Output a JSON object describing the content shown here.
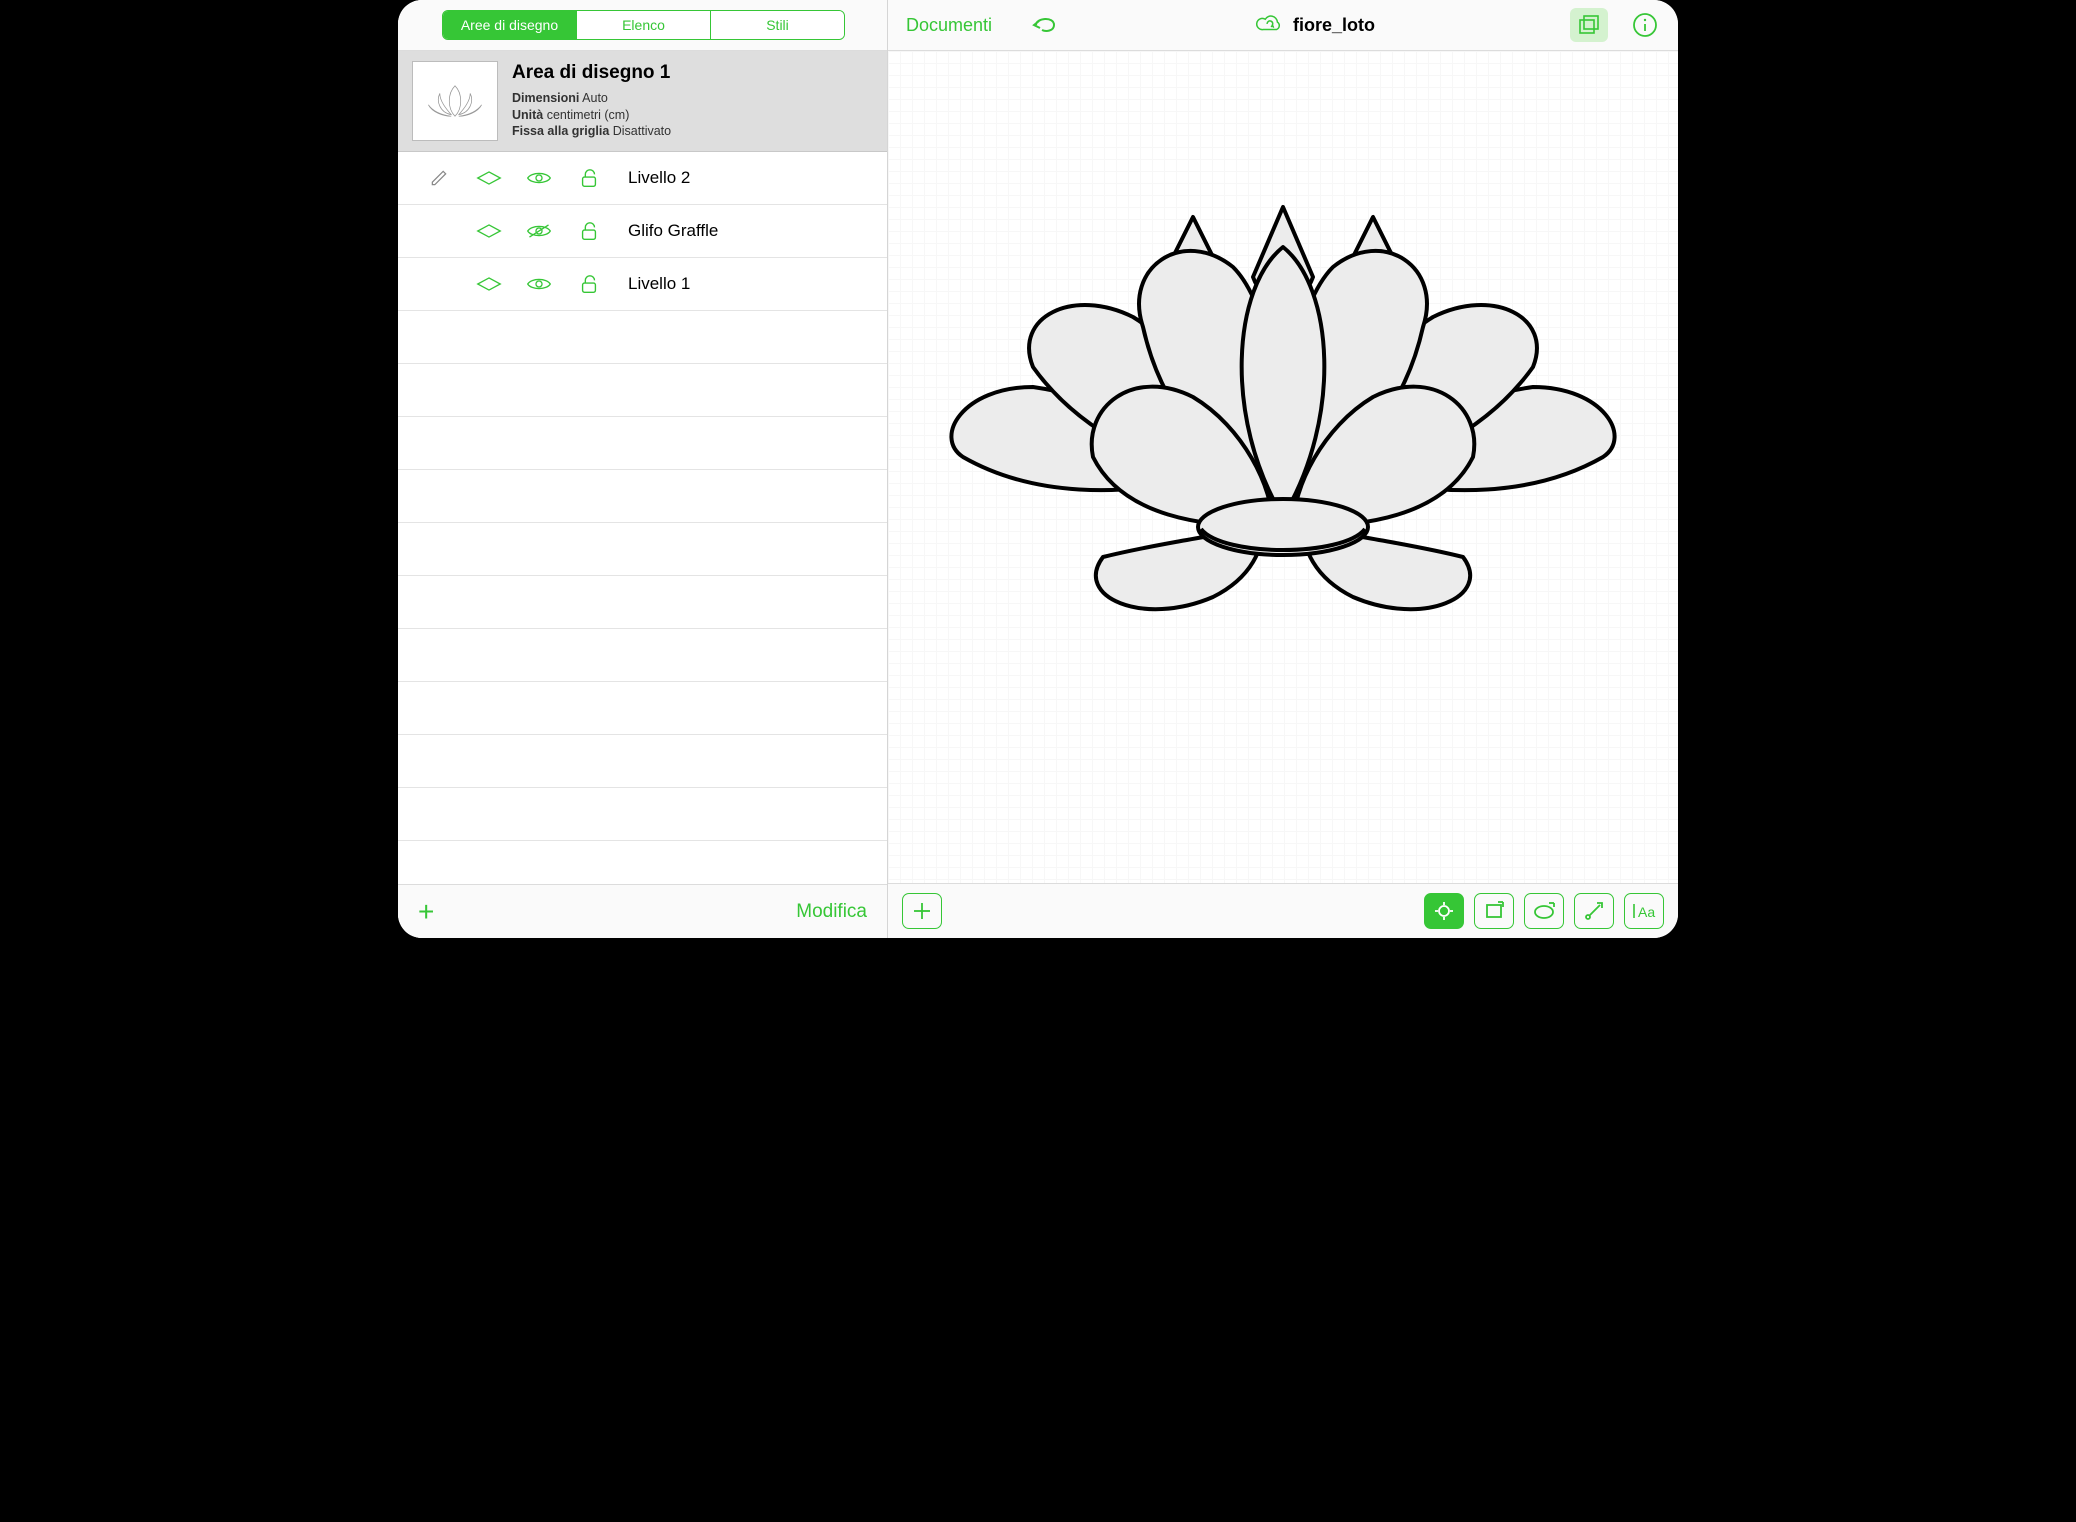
{
  "sidebar": {
    "tabs": {
      "artboards": "Aree di disegno",
      "list": "Elenco",
      "styles": "Stili",
      "active": 0
    },
    "artboard": {
      "title": "Area di disegno 1",
      "dimensions_label": "Dimensioni",
      "dimensions_value": "Auto",
      "units_label": "Unità",
      "units_value": "centimetri (cm)",
      "snap_label": "Fissa alla griglia",
      "snap_value": "Disattivato"
    },
    "layers": [
      {
        "name": "Livello 2",
        "visible": true,
        "locked": false,
        "has_pencil": true
      },
      {
        "name": "Glifo Graffle",
        "visible": false,
        "locked": false,
        "has_pencil": false
      },
      {
        "name": "Livello 1",
        "visible": true,
        "locked": false,
        "has_pencil": false
      }
    ],
    "bottom": {
      "add": "+",
      "edit": "Modifica"
    }
  },
  "topbar": {
    "documents": "Documenti",
    "filename": "fiore_loto"
  },
  "tools": {
    "add_shape": "add-shape",
    "freehand": "freehand-tool",
    "rectangle": "rectangle-tool",
    "oval": "oval-tool",
    "line": "line-tool",
    "text": "text-tool"
  }
}
